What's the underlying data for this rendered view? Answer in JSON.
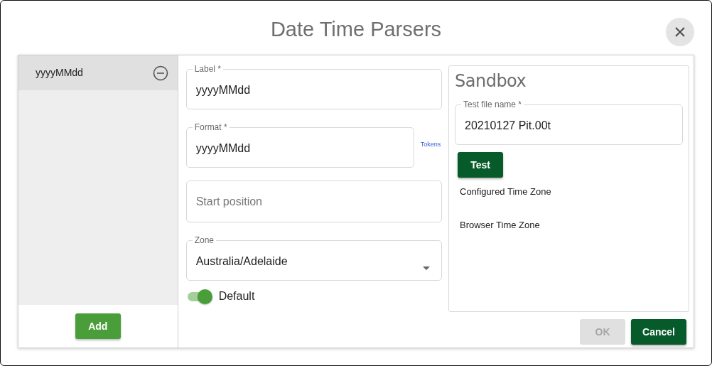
{
  "title": "Date Time Parsers",
  "parsers": [
    {
      "label": "yyyyMMdd",
      "selected": true
    }
  ],
  "add_button": "Add",
  "form": {
    "fields": [
      {
        "kind": "text",
        "label": "Label *",
        "value": "yyyyMMdd"
      },
      {
        "kind": "text",
        "label": "Format *",
        "value": "yyyyMMdd",
        "link": "Tokens"
      },
      {
        "kind": "text",
        "placeholder": "Start position"
      },
      {
        "kind": "select",
        "label": "Zone",
        "value": "Australia/Adelaide"
      }
    ],
    "toggle": {
      "label": "Default",
      "on": true
    }
  },
  "sandbox": {
    "title": "Sandbox",
    "field": {
      "label": "Test file name *",
      "value": "20210127 Pit.00t"
    },
    "test_button": "Test",
    "lines": [
      "Configured Time Zone",
      "Browser Time Zone"
    ]
  },
  "buttons": [
    {
      "label": "OK",
      "disabled": true
    },
    {
      "label": "Cancel",
      "disabled": false
    }
  ]
}
